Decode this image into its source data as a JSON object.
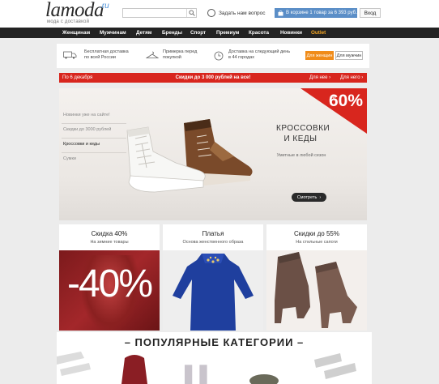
{
  "header": {
    "logo_main": "lamoda",
    "logo_domain": ".ru",
    "logo_tagline": "мода с доставкой",
    "search_placeholder": "",
    "ask_label": "Задать нам вопрос",
    "cart_label": "В корзине 1 товар за 6 393 руб.",
    "login_label": "Вход"
  },
  "nav": {
    "items": [
      "Женщинам",
      "Мужчинам",
      "Детям",
      "Бренды",
      "Спорт",
      "Премиум",
      "Красота",
      "Новинки",
      "Outlet"
    ]
  },
  "benefits": {
    "items": [
      {
        "text1": "Бесплатная доставка",
        "text2": "по всей России"
      },
      {
        "text1": "Примерка перед",
        "text2": "покупкой"
      },
      {
        "text1": "Доставка на следующий день",
        "text2": "в 44 городах"
      }
    ],
    "women_button": "Для женщин",
    "men_button": "Для мужчин"
  },
  "promo_bar": {
    "left": "По 6 декабря",
    "center": "Скидки до 3 000 рублей на все!",
    "women_link": "Для нее ›",
    "men_link": "Для него ›"
  },
  "hero": {
    "side_links": [
      "Новинки уже на сайте!",
      "Скидки до 3000 рублей",
      "Кроссовки и кеды",
      "Сумки"
    ],
    "title_line1": "КРОССОВКИ",
    "title_line2": "И КЕДЫ",
    "subtitle": "Уметные в любой сезон",
    "cta": "Смотреть",
    "badge_prefix": "до",
    "badge_value": "60%"
  },
  "cards": [
    {
      "title": "Скидка 40%",
      "subtitle": "На зимние товары",
      "image_text": "-40%"
    },
    {
      "title": "Платья",
      "subtitle": "Основа женственного образа"
    },
    {
      "title": "Скидки до 55%",
      "subtitle": "На стильные сапоги"
    }
  ],
  "popular": {
    "title": "ПОПУЛЯРНЫЕ КАТЕГОРИИ"
  },
  "colors": {
    "accent_red": "#d8261e",
    "nav_bg": "#232323",
    "outlet_orange": "#f5a623",
    "cart_blue": "#5b8ec7"
  }
}
